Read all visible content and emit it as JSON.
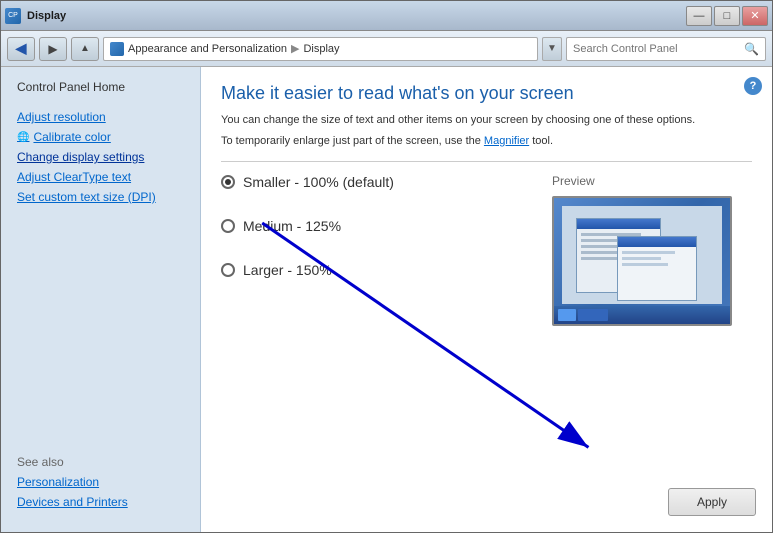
{
  "window": {
    "title": "Display",
    "icon": "CP"
  },
  "titlebar": {
    "minimize": "—",
    "maximize": "□",
    "close": "✕"
  },
  "addressbar": {
    "breadcrumb_prefix": "Appearance and Personalization",
    "breadcrumb_sep": "▶",
    "breadcrumb_current": "Display",
    "search_placeholder": "Search Control Panel",
    "forward_arrow": "▶"
  },
  "sidebar": {
    "control_panel_home": "Control Panel Home",
    "links": [
      {
        "id": "adjust-resolution",
        "label": "Adjust resolution"
      },
      {
        "id": "calibrate-color",
        "label": "Calibrate color"
      },
      {
        "id": "change-display-settings",
        "label": "Change display settings",
        "active": true
      },
      {
        "id": "adjust-cleartype",
        "label": "Adjust ClearType text"
      },
      {
        "id": "set-custom-text",
        "label": "Set custom text size (DPI)"
      }
    ],
    "see_also": "See also",
    "bottom_links": [
      {
        "id": "personalization",
        "label": "Personalization"
      },
      {
        "id": "devices-printers",
        "label": "Devices and Printers"
      }
    ]
  },
  "content": {
    "title": "Make it easier to read what's on your screen",
    "desc1": "You can change the size of text and other items on your screen by choosing one of these options.",
    "desc2": "To temporarily enlarge just part of the screen, use the",
    "magnifier_text": "Magnifier",
    "desc3": "tool.",
    "options": [
      {
        "id": "smaller",
        "label": "Smaller - 100% (default)",
        "selected": true
      },
      {
        "id": "medium",
        "label": "Medium - 125%",
        "selected": false
      },
      {
        "id": "larger",
        "label": "Larger - 150%",
        "selected": false
      }
    ],
    "preview_label": "Preview",
    "apply_label": "Apply",
    "help_icon": "?"
  }
}
